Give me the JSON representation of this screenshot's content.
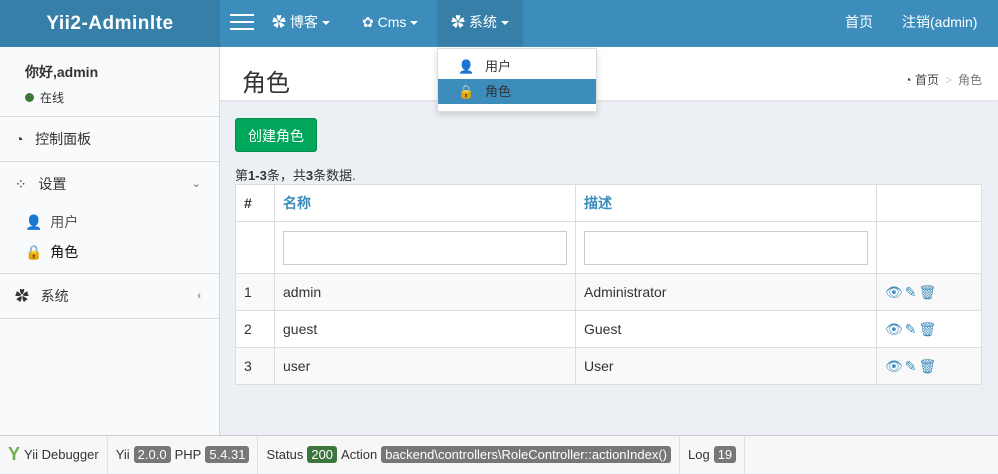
{
  "header": {
    "logo": "Yii2-Adminlte",
    "nav": [
      {
        "label": "博客"
      },
      {
        "label": "Cms"
      },
      {
        "label": "系统"
      }
    ],
    "right": [
      "首页",
      "注销(admin)"
    ]
  },
  "dropdown": [
    "用户",
    "角色"
  ],
  "sidebar": {
    "greeting": "你好,admin",
    "status": "在线",
    "items": [
      "控制面板",
      "设置",
      "用户",
      "角色",
      "系统"
    ]
  },
  "page": {
    "title": "角色",
    "breadcrumb": [
      "首页",
      "角色"
    ],
    "create_button": "创建角色",
    "summary_prefix": "第",
    "summary_range": "1-3",
    "summary_mid": "条，共",
    "summary_total": "3",
    "summary_suffix": "条数据."
  },
  "table": {
    "headers": [
      "#",
      "名称",
      "描述",
      ""
    ],
    "rows": [
      [
        "1",
        "admin",
        "Administrator"
      ],
      [
        "2",
        "guest",
        "Guest"
      ],
      [
        "3",
        "user",
        "User"
      ]
    ]
  },
  "debug": {
    "label": "Yii Debugger",
    "yii": "Yii",
    "yii_ver": "2.0.0",
    "php": "PHP",
    "php_ver": "5.4.31",
    "status": "Status",
    "status_code": "200",
    "action": "Action",
    "action_val": "backend\\controllers\\RoleController::actionIndex()",
    "log": "Log",
    "log_count": "19"
  }
}
